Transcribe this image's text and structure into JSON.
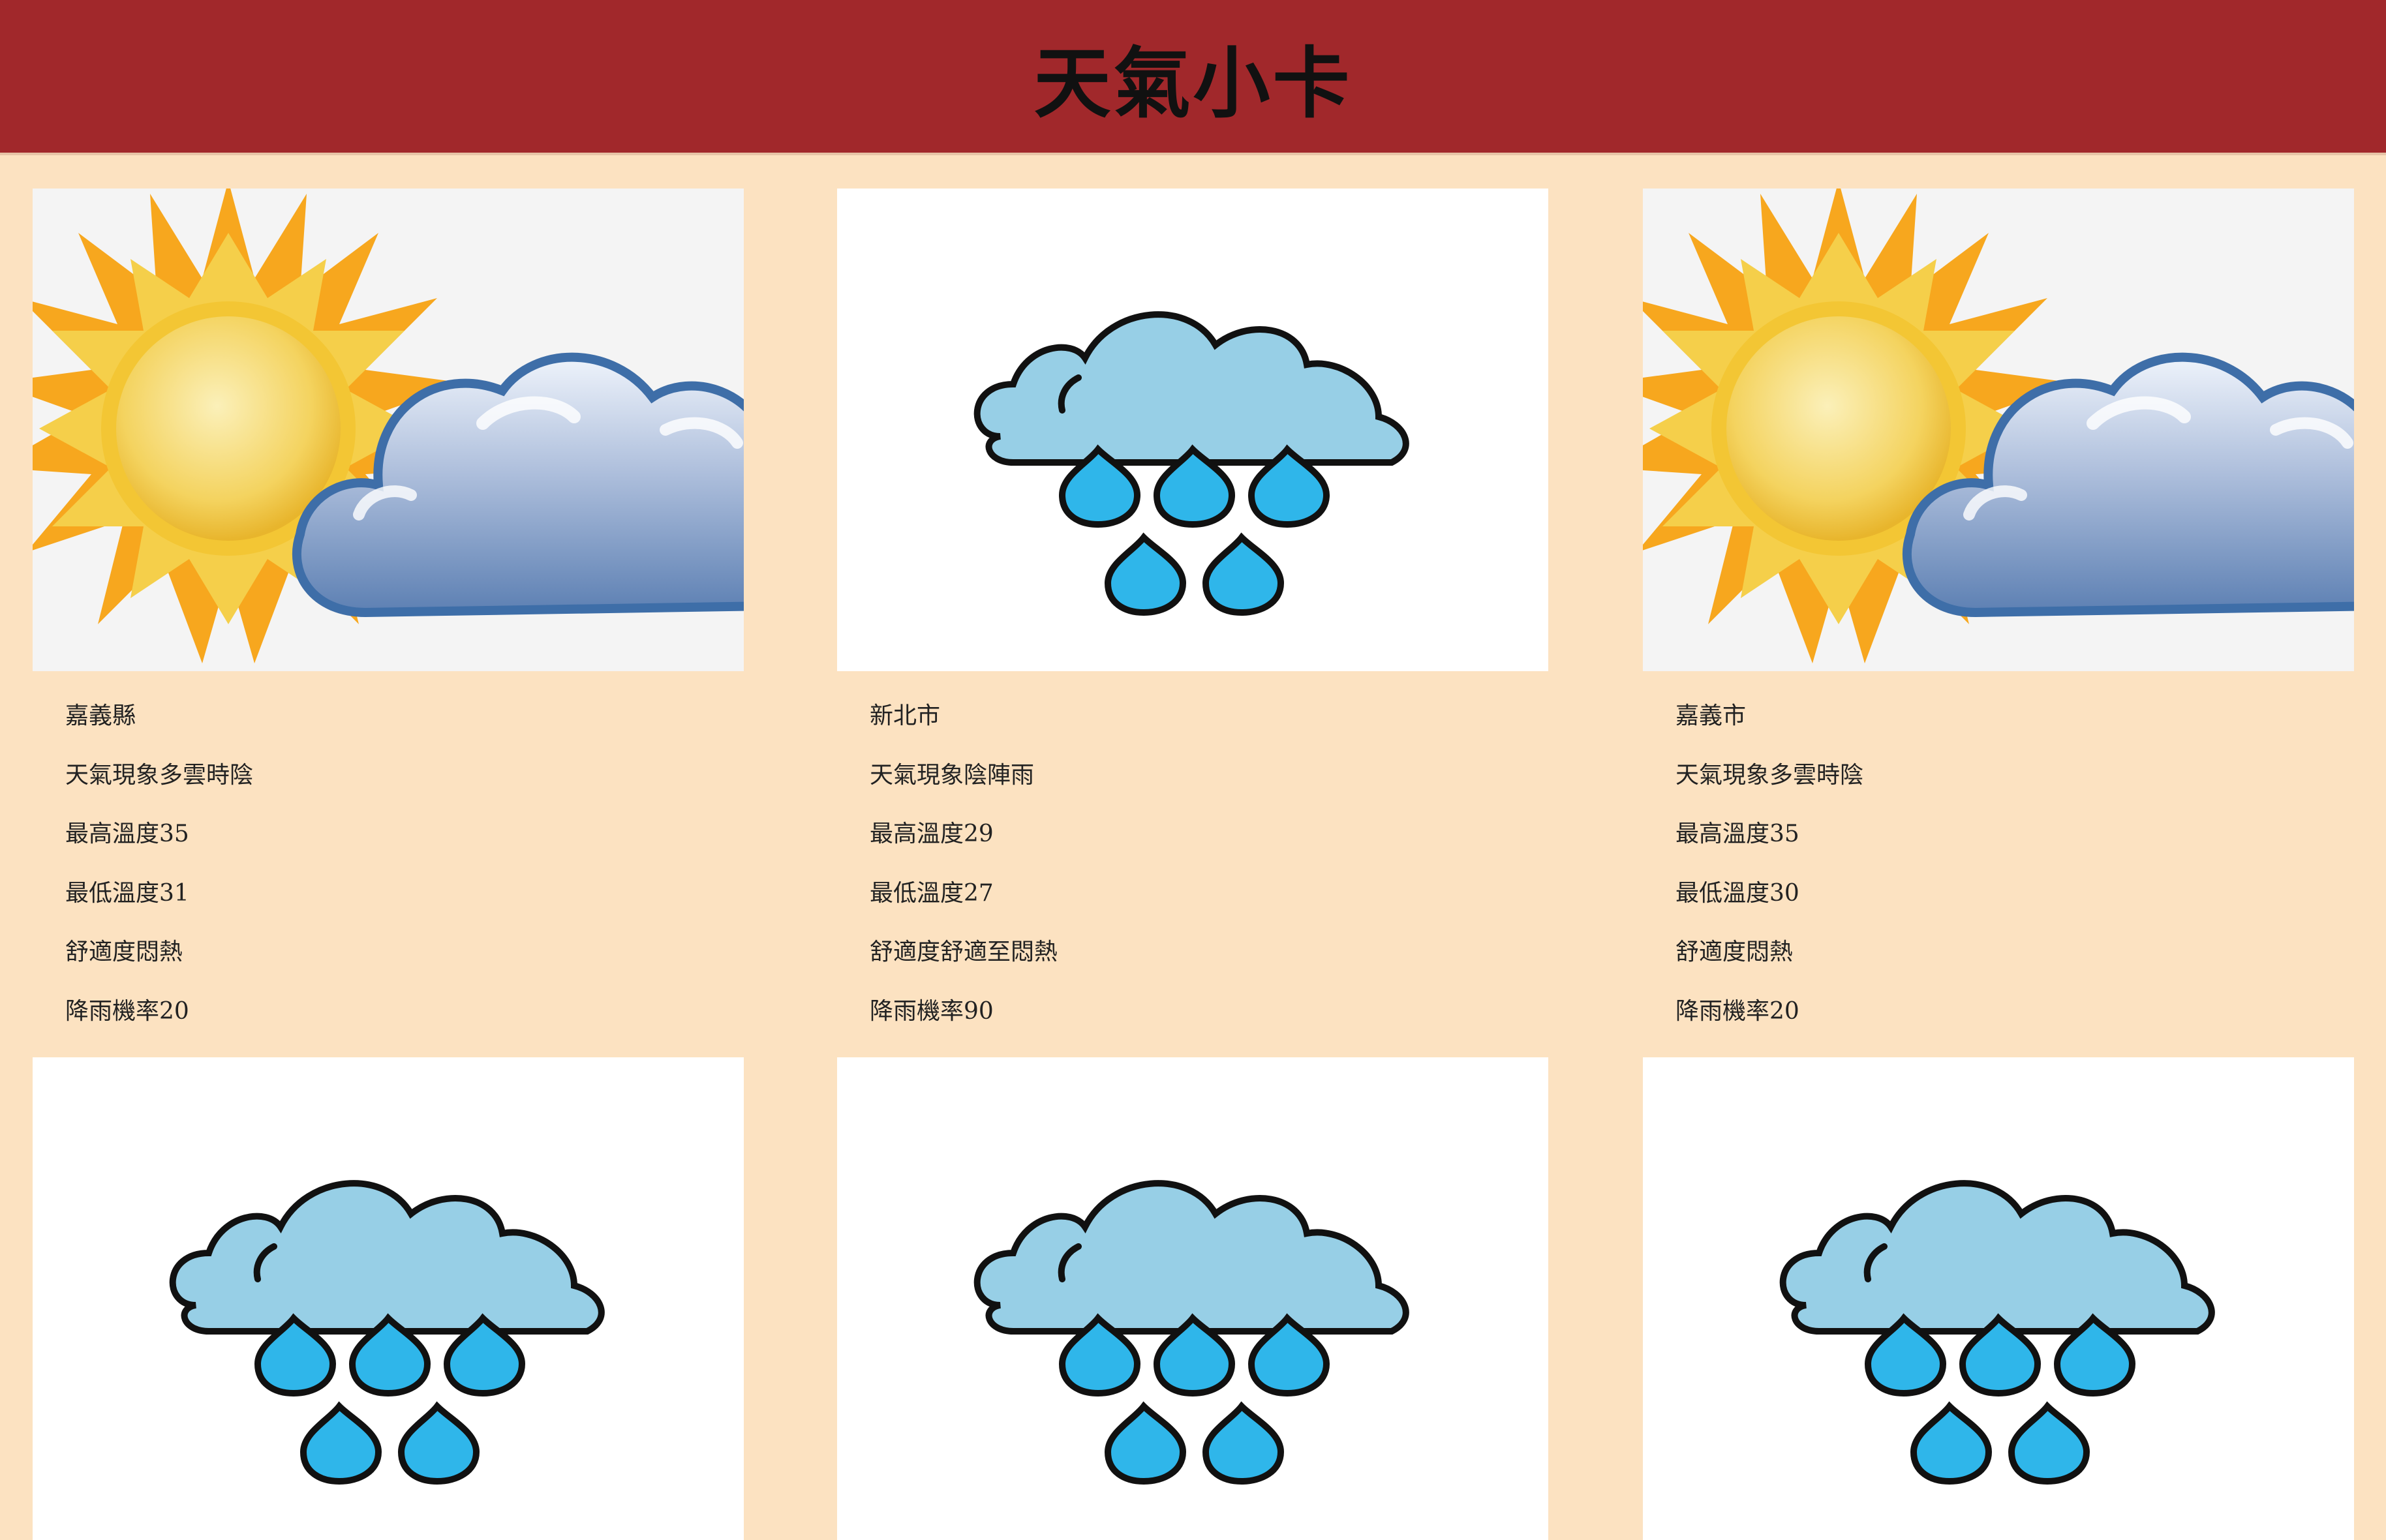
{
  "page": {
    "title": "天氣小卡"
  },
  "cards": [
    {
      "icon": "partly-cloudy-icon",
      "city": "嘉義縣",
      "weather": "天氣現象多雲時陰",
      "max_temp": "最高溫度35",
      "min_temp": "最低溫度31",
      "comfort": "舒適度悶熱",
      "rain": "降雨機率20"
    },
    {
      "icon": "rain-cloud-icon",
      "city": "新北市",
      "weather": "天氣現象陰陣雨",
      "max_temp": "最高溫度29",
      "min_temp": "最低溫度27",
      "comfort": "舒適度舒適至悶熱",
      "rain": "降雨機率90"
    },
    {
      "icon": "partly-cloudy-icon",
      "city": "嘉義市",
      "weather": "天氣現象多雲時陰",
      "max_temp": "最高溫度35",
      "min_temp": "最低溫度30",
      "comfort": "舒適度悶熱",
      "rain": "降雨機率20"
    },
    {
      "icon": "rain-cloud-icon"
    },
    {
      "icon": "rain-cloud-icon"
    },
    {
      "icon": "rain-cloud-icon"
    }
  ],
  "colors": {
    "header_bg": "#a1282b",
    "page_bg": "#fce2c1",
    "sun_ray": "#f5a623",
    "sun_core": "#f6d76a",
    "cloud_blue": "#8ea9cc",
    "rain_cloud": "#97cfe6",
    "rain_drop": "#2fb6ea"
  }
}
